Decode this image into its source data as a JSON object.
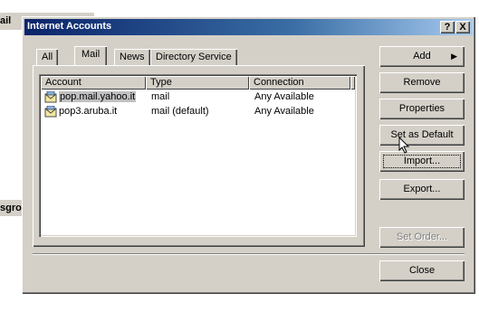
{
  "background": {
    "top_text": "ail",
    "mid_text": "sgro"
  },
  "window": {
    "title": "Internet Accounts",
    "help_label": "?",
    "close_label": "X"
  },
  "tabs": [
    {
      "label": "All"
    },
    {
      "label": "Mail",
      "selected": true
    },
    {
      "label": "News"
    },
    {
      "label": "Directory Service"
    }
  ],
  "list": {
    "columns": [
      "Account",
      "Type",
      "Connection"
    ],
    "rows": [
      {
        "account": "pop.mail.yahoo.it",
        "type": "mail",
        "connection": "Any Available",
        "selected": true
      },
      {
        "account": "pop3.aruba.it",
        "type": "mail (default)",
        "connection": "Any Available"
      }
    ]
  },
  "buttons": {
    "add": "Add",
    "remove": "Remove",
    "properties": "Properties",
    "set_default": "Set as Default",
    "import": "Import...",
    "export": "Export...",
    "set_order": "Set Order...",
    "close": "Close"
  },
  "colors": {
    "title_gradient_start": "#0a246a",
    "face": "#d4d0c8",
    "selection": "#c0c0c0"
  }
}
